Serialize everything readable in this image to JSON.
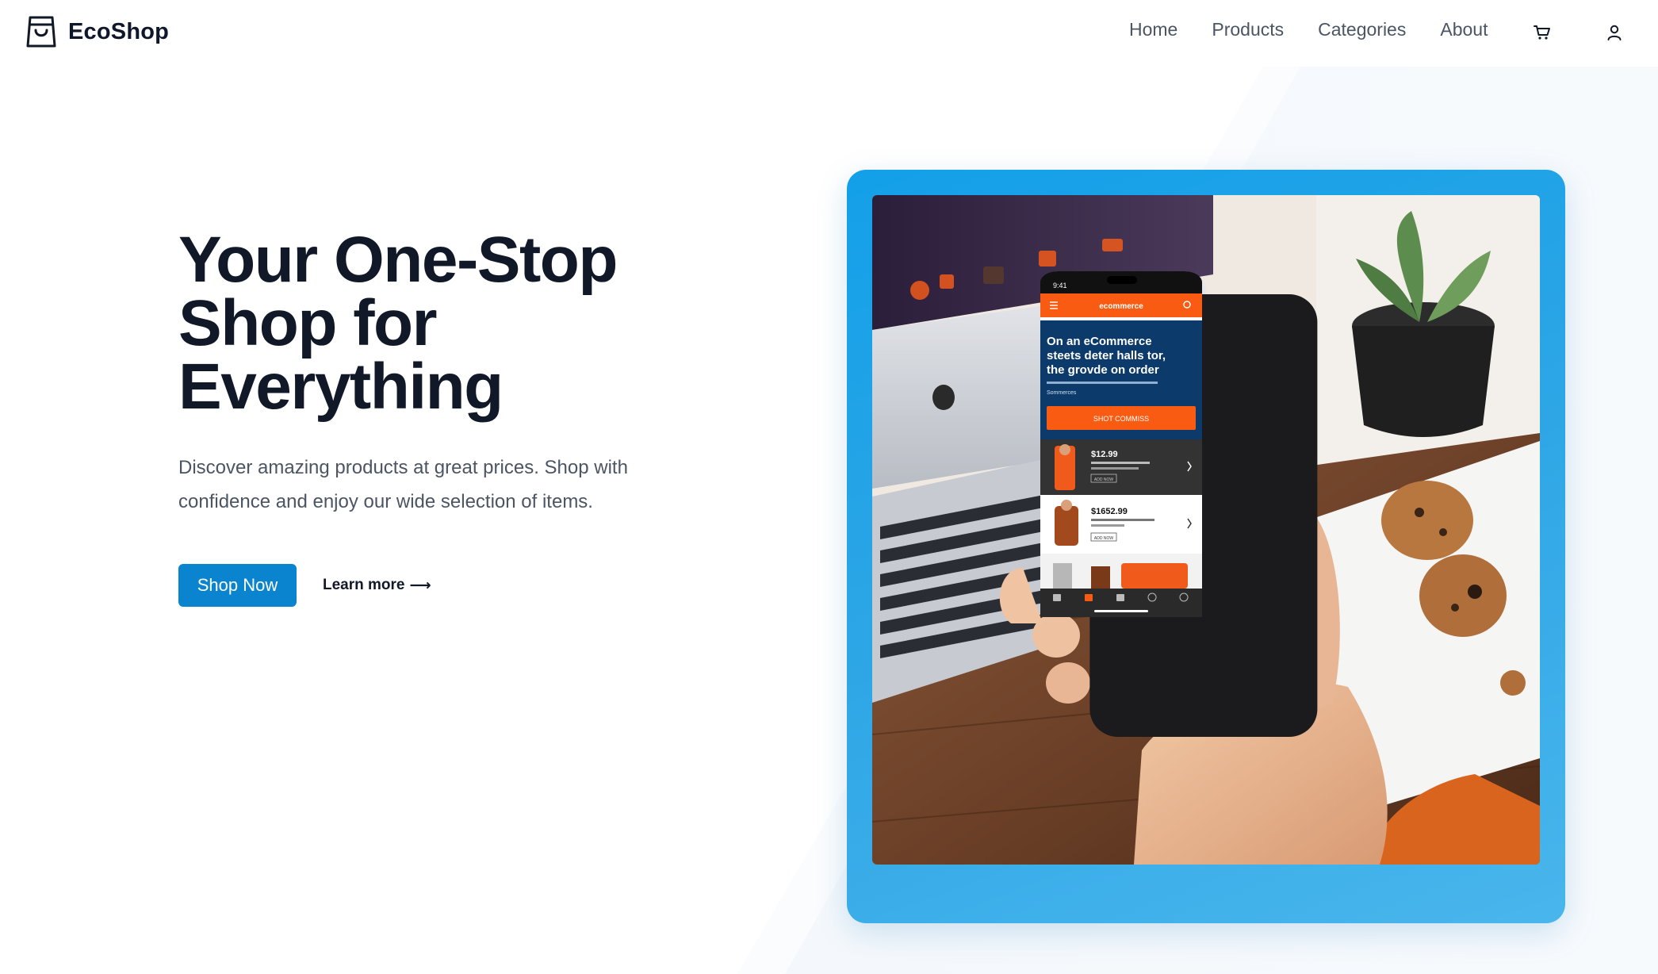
{
  "brand": {
    "name": "EcoShop",
    "icon": "shopping-bag-icon"
  },
  "nav": {
    "links": [
      "Home",
      "Products",
      "Categories",
      "About"
    ],
    "cart_icon": "shopping-cart-icon",
    "user_icon": "user-icon"
  },
  "hero": {
    "title_lines": [
      "Your One-Stop",
      "Shop for",
      "Everything"
    ],
    "description": "Discover amazing products at great prices. Shop with confidence and enjoy our wide selection of items.",
    "primary_button": "Shop Now",
    "secondary_link": "Learn more",
    "secondary_arrow": "⟶"
  },
  "hero_image": {
    "phone_app_name": "ecommerce",
    "phone_status_time": "9:41",
    "phone_banner_heading": [
      "On an eCommerce",
      "steets deter halls tor,",
      "the grovde on order"
    ],
    "phone_banner_sub": "Sommerces",
    "phone_banner_button": "SHOT COMMISS",
    "phone_items": [
      {
        "price": "$12.99",
        "button": "ADD NOW"
      },
      {
        "price": "$1652.99",
        "button": "ADD NOW"
      }
    ]
  },
  "colors": {
    "accent": "#0b84cf",
    "card_blue": "#2ea6e6",
    "phone_orange": "#f95b12",
    "phone_navy": "#0b3a6b",
    "heading": "#111827",
    "body_text": "#4b5563"
  }
}
